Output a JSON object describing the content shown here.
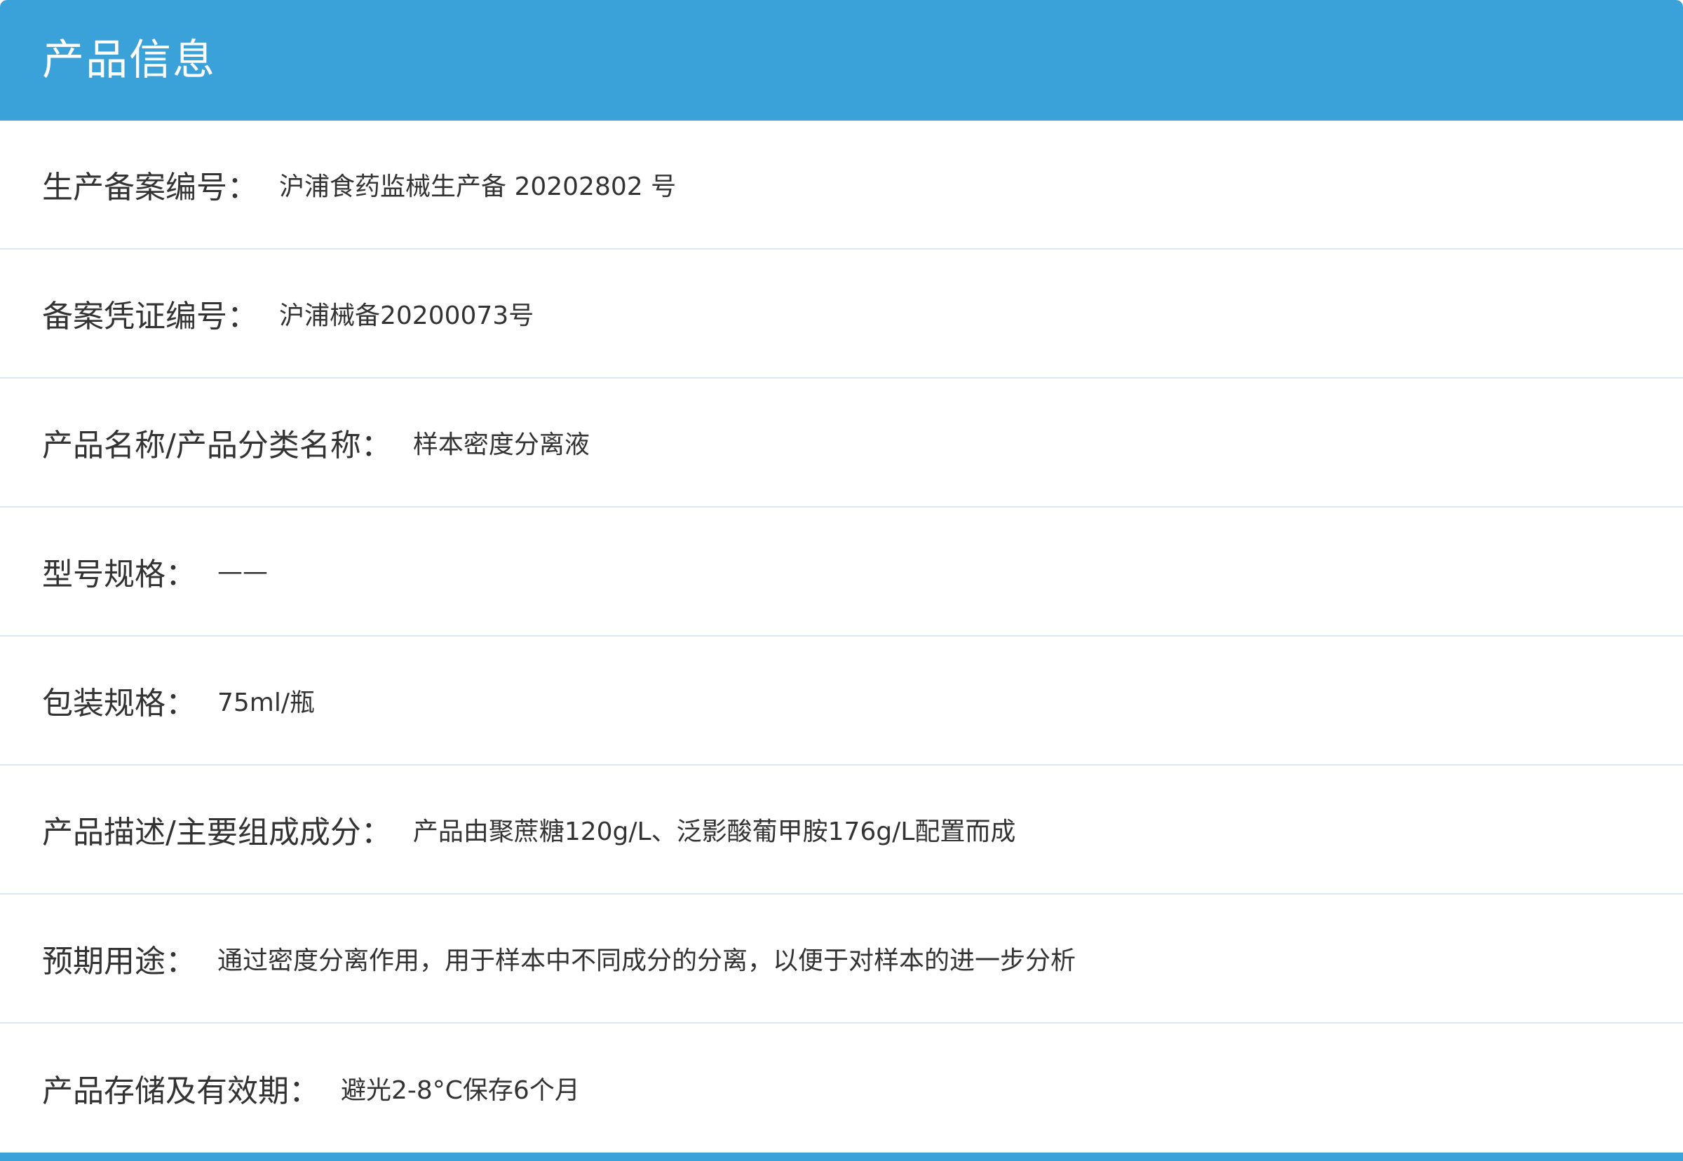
{
  "header": {
    "title": "产品信息"
  },
  "rows": [
    {
      "label": "生产备案编号：",
      "value": "沪浦食药监械生产备 20202802 号"
    },
    {
      "label": "备案凭证编号：",
      "value": "沪浦械备20200073号"
    },
    {
      "label": "产品名称/产品分类名称：",
      "value": "样本密度分离液"
    },
    {
      "label": "型号规格：",
      "value": "——"
    },
    {
      "label": "包装规格：",
      "value": "75ml/瓶"
    },
    {
      "label": "产品描述/主要组成成分：",
      "value": "产品由聚蔗糖120g/L、泛影酸葡甲胺176g/L配置而成"
    },
    {
      "label": "预期用途：",
      "value": "通过密度分离作用，用于样本中不同成分的分离，以便于对样本的进一步分析"
    },
    {
      "label": "产品存储及有效期：",
      "value": "避光2-8°C保存6个月"
    }
  ],
  "colors": {
    "accent": "#3aa2d8",
    "divider": "#d8eaf4",
    "text": "#333333"
  }
}
